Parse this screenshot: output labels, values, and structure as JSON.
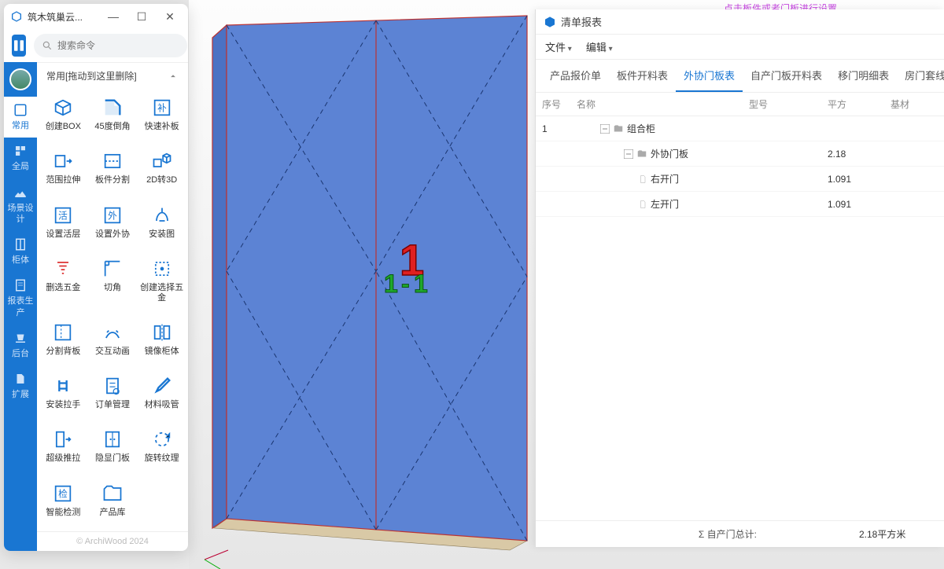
{
  "tool_window": {
    "title": "筑木筑巢云...",
    "search_placeholder": "搜索命令",
    "group_header": "常用[拖动到这里删除]",
    "footer": "© ArchiWood 2024",
    "left_tabs": [
      {
        "label": "常用",
        "active": true
      },
      {
        "label": "全局",
        "active": false
      },
      {
        "label": "场景设计",
        "active": false
      },
      {
        "label": "柜体",
        "active": false
      },
      {
        "label": "报表生产",
        "active": false
      },
      {
        "label": "后台",
        "active": false
      },
      {
        "label": "扩展",
        "active": false
      }
    ],
    "tools": [
      {
        "label": "创建BOX"
      },
      {
        "label": "45度倒角"
      },
      {
        "label": "快速补板"
      },
      {
        "label": "范围拉伸"
      },
      {
        "label": "板件分割"
      },
      {
        "label": "2D转3D"
      },
      {
        "label": "设置活层"
      },
      {
        "label": "设置外协"
      },
      {
        "label": "安装图"
      },
      {
        "label": "删选五金"
      },
      {
        "label": "切角"
      },
      {
        "label": "创建选择五金"
      },
      {
        "label": "分割背板"
      },
      {
        "label": "交互动画"
      },
      {
        "label": "镜像柜体"
      },
      {
        "label": "安装拉手"
      },
      {
        "label": "订单管理"
      },
      {
        "label": "材料吸管"
      },
      {
        "label": "超级推拉"
      },
      {
        "label": "隐显门板"
      },
      {
        "label": "旋转纹理"
      },
      {
        "label": "智能检测"
      },
      {
        "label": "产品库"
      }
    ]
  },
  "viewport": {
    "hint": "点击板件或者门板进行设置",
    "labels": {
      "main": "1",
      "left": "1",
      "dash": "-",
      "right": "1"
    }
  },
  "report_panel": {
    "title": "清单报表",
    "menu": [
      "文件",
      "编辑"
    ],
    "tabs": [
      {
        "label": "产品报价单",
        "active": false
      },
      {
        "label": "板件开料表",
        "active": false
      },
      {
        "label": "外协门板表",
        "active": true
      },
      {
        "label": "自产门板开料表",
        "active": false
      },
      {
        "label": "移门明细表",
        "active": false
      },
      {
        "label": "房门套线明",
        "active": false
      }
    ],
    "columns": {
      "seq": "序号",
      "name": "名称",
      "model": "型号",
      "area": "平方",
      "base": "基材"
    },
    "rows": [
      {
        "seq": "1",
        "name": "组合柜",
        "indent": 1,
        "type": "folder",
        "area": ""
      },
      {
        "seq": "",
        "name": "外协门板",
        "indent": 2,
        "type": "folder",
        "area": "2.18"
      },
      {
        "seq": "",
        "name": "右开门",
        "indent": 3,
        "type": "file",
        "area": "1.091"
      },
      {
        "seq": "",
        "name": "左开门",
        "indent": 3,
        "type": "file",
        "area": "1.091"
      }
    ],
    "footer": {
      "label": "Σ 自产门总计:",
      "value": "2.18平方米"
    }
  }
}
